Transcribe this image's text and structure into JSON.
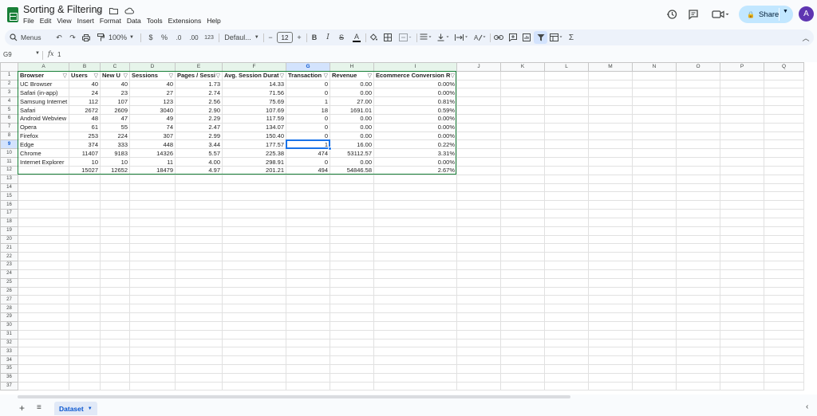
{
  "app": {
    "title": "Sorting & Filtering",
    "menu": [
      "File",
      "Edit",
      "View",
      "Insert",
      "Format",
      "Data",
      "Tools",
      "Extensions",
      "Help"
    ],
    "share_label": "Share",
    "avatar_letter": "A"
  },
  "toolbar": {
    "menus_label": "Menus",
    "zoom": "100%",
    "currency": "$",
    "percent": "%",
    "dec_decrease": ".0",
    "dec_increase": ".00",
    "number_format": "123",
    "font": "Defaul...",
    "font_size": "12",
    "minus": "−",
    "plus": "+",
    "bold": "B",
    "italic": "I",
    "strike": "S",
    "text_color": "A",
    "sum": "Σ"
  },
  "formula_bar": {
    "cell_ref": "G9",
    "fx": "fx",
    "value": "1"
  },
  "grid": {
    "columns": [
      "A",
      "B",
      "C",
      "D",
      "E",
      "F",
      "G",
      "H",
      "I",
      "J",
      "K",
      "L",
      "M",
      "N",
      "O",
      "P",
      "Q"
    ],
    "selected_column": "G",
    "selected_row": 9,
    "row_count": 37,
    "header_row": [
      "Browser",
      "Users",
      "New U",
      "Sessions",
      "Pages / Sessi",
      "Avg. Session Durat",
      "Transaction",
      "Revenue",
      "Ecommerce Conversion R"
    ],
    "rows": [
      [
        "UC Browser",
        "40",
        "40",
        "40",
        "1.73",
        "14.33",
        "0",
        "0.00",
        "0.00%"
      ],
      [
        "Safari (in-app)",
        "24",
        "23",
        "27",
        "2.74",
        "71.56",
        "0",
        "0.00",
        "0.00%"
      ],
      [
        "Samsung Internet",
        "112",
        "107",
        "123",
        "2.56",
        "75.69",
        "1",
        "27.00",
        "0.81%"
      ],
      [
        "Safari",
        "2672",
        "2609",
        "3040",
        "2.90",
        "107.69",
        "18",
        "1691.01",
        "0.59%"
      ],
      [
        "Android Webview",
        "48",
        "47",
        "49",
        "2.29",
        "117.59",
        "0",
        "0.00",
        "0.00%"
      ],
      [
        "Opera",
        "61",
        "55",
        "74",
        "2.47",
        "134.07",
        "0",
        "0.00",
        "0.00%"
      ],
      [
        "Firefox",
        "253",
        "224",
        "307",
        "2.99",
        "150.40",
        "0",
        "0.00",
        "0.00%"
      ],
      [
        "Edge",
        "374",
        "333",
        "448",
        "3.44",
        "177.57",
        "1",
        "16.00",
        "0.22%"
      ],
      [
        "Chrome",
        "11407",
        "9183",
        "14326",
        "5.57",
        "225.38",
        "474",
        "53112.57",
        "3.31%"
      ],
      [
        "Internet Explorer",
        "10",
        "10",
        "11",
        "4.00",
        "298.91",
        "0",
        "0.00",
        "0.00%"
      ],
      [
        "",
        "15027",
        "12652",
        "18479",
        "4.97",
        "201.21",
        "494",
        "54846.58",
        "2.67%"
      ]
    ]
  },
  "sheets": {
    "active": "Dataset"
  },
  "colors": {
    "accent": "#0b57d0",
    "share_bg": "#c2e7ff",
    "table_outline": "#188038",
    "selection": "#1a73e8"
  }
}
